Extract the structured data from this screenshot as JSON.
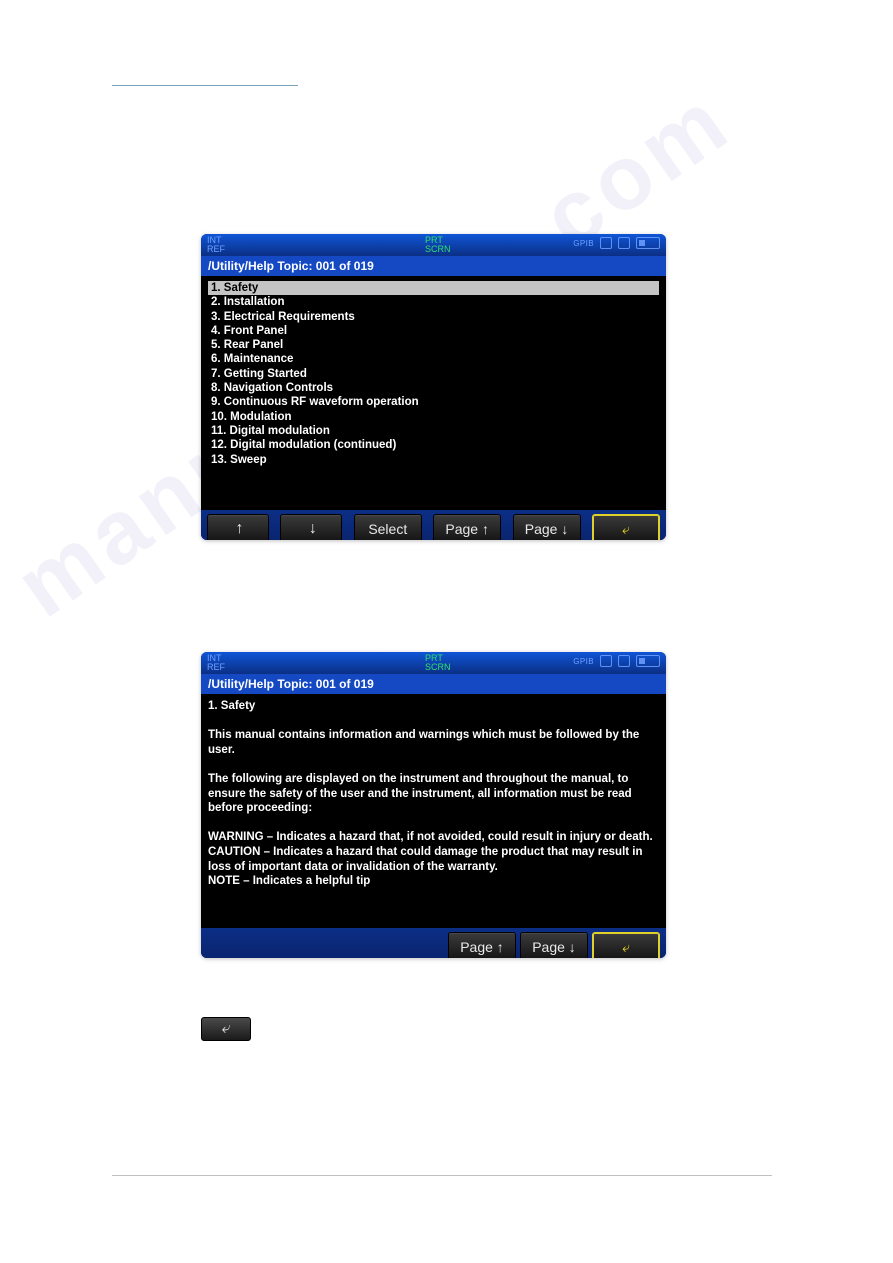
{
  "watermark": "manualshive.com",
  "screen1": {
    "status": {
      "left_line1": "INT",
      "left_line2": "REF",
      "center_line1": "PRT",
      "center_line2": "SCRN",
      "gpib_label": "GPIB"
    },
    "path": "/Utility/Help Topic: 001 of 019",
    "topics": [
      "1. Safety",
      "2. Installation",
      "3. Electrical Requirements",
      "4. Front Panel",
      "5. Rear Panel",
      "6. Maintenance",
      "7. Getting Started",
      "8. Navigation Controls",
      "9. Continuous RF waveform operation",
      "10. Modulation",
      "11. Digital modulation",
      "12. Digital modulation (continued)",
      "13. Sweep"
    ],
    "selected_index": 0,
    "softkeys": {
      "up": "↑",
      "down": "↓",
      "select": "Select",
      "page_up": "Page ↑",
      "page_down": "Page ↓",
      "back": "⤶"
    }
  },
  "screen2": {
    "status": {
      "left_line1": "INT",
      "left_line2": "REF",
      "center_line1": "PRT",
      "center_line2": "SCRN",
      "gpib_label": "GPIB"
    },
    "path": "/Utility/Help Topic: 001 of 019",
    "detail": "1. Safety\n\nThis manual contains information and warnings which must be followed by the user.\n\nThe following are displayed on the instrument and throughout the manual, to ensure the safety of the user and the instrument, all information must be read before proceeding:\n\nWARNING – Indicates a hazard that, if not avoided, could result in injury or death.\nCAUTION – Indicates a hazard that could damage the product that may result in loss of important data or invalidation of the warranty.\nNOTE – Indicates a helpful tip",
    "softkeys": {
      "page_up": "Page ↑",
      "page_down": "Page ↓",
      "back": "⤶"
    }
  },
  "mini_back": "⤶"
}
